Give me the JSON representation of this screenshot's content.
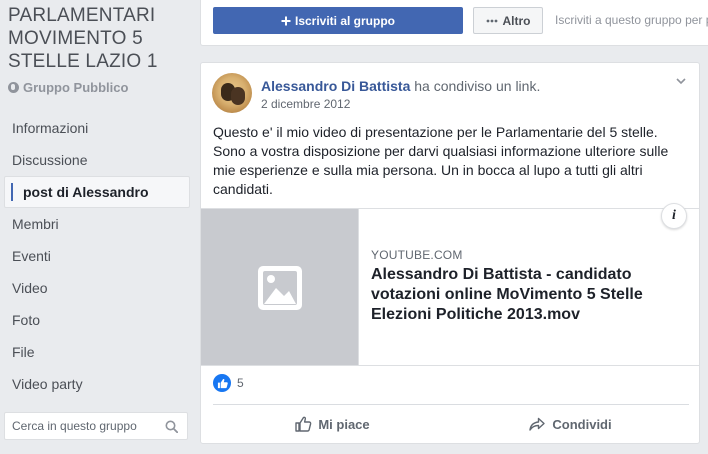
{
  "group": {
    "title": "PARLAMENTARI MOVIMENTO 5 STELLE LAZIO 1",
    "type": "Gruppo Pubblico"
  },
  "nav": {
    "items": [
      {
        "label": "Informazioni",
        "active": false
      },
      {
        "label": "Discussione",
        "active": false
      },
      {
        "label": "post di Alessandro",
        "active": true
      },
      {
        "label": "Membri",
        "active": false
      },
      {
        "label": "Eventi",
        "active": false
      },
      {
        "label": "Video",
        "active": false
      },
      {
        "label": "Foto",
        "active": false
      },
      {
        "label": "File",
        "active": false
      },
      {
        "label": "Video party",
        "active": false
      }
    ]
  },
  "search": {
    "placeholder": "Cerca in questo gruppo"
  },
  "topbar": {
    "join_label": "Iscriviti al gruppo",
    "more_label": "Altro",
    "note": "Iscriviti a questo gruppo per p"
  },
  "post": {
    "author": "Alessandro Di Battista",
    "action": "ha condiviso un link.",
    "date": "2 dicembre 2012",
    "text": "Questo e' il mio video di presentazione per le Parlamentarie del 5 stelle. Sono a vostra disposizione per darvi qualsiasi informazione ulteriore sulle mie esperienze e sulla mia persona. Un in bocca al lupo a tutti gli altri candidati.",
    "link": {
      "domain": "YOUTUBE.COM",
      "title": "Alessandro Di Battista - candidato votazioni online MoVimento 5 Stelle Elezioni Politiche 2013.mov",
      "info": "i"
    },
    "likes": "5",
    "actions": {
      "like_label": "Mi piace",
      "share_label": "Condividi"
    }
  },
  "colors": {
    "brand": "#4267b2",
    "link": "#385898",
    "background": "#e9ebee",
    "like_blue": "#1877f2"
  },
  "icons": [
    "globe-icon",
    "search-icon",
    "plus-icon",
    "ellipsis-icon",
    "chevron-down-icon",
    "image-placeholder-icon",
    "info-icon",
    "like-icon",
    "thumbs-up-icon",
    "share-icon"
  ]
}
